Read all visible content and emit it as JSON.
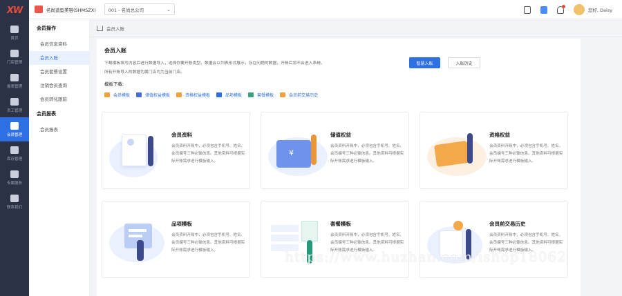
{
  "brand": {
    "logo_text": "XW"
  },
  "rail": [
    {
      "label": "首页",
      "icon": "home-icon"
    },
    {
      "label": "门店管理",
      "icon": "store-icon"
    },
    {
      "label": "报表管理",
      "icon": "chart-icon"
    },
    {
      "label": "员工管理",
      "icon": "staff-icon"
    },
    {
      "label": "会员管理",
      "icon": "member-icon",
      "active": true
    },
    {
      "label": "库存管理",
      "icon": "stock-icon"
    },
    {
      "label": "专属服务",
      "icon": "service-icon"
    },
    {
      "label": "联系我们",
      "icon": "contact-icon"
    }
  ],
  "topbar": {
    "store_name": "名尚造型美容(SHMSZX)",
    "branch_select": "001 - 名尚总公司",
    "user_greeting": "您好,  Daisy"
  },
  "subnav": {
    "group1": "会员操作",
    "items1": [
      "会员信息资料",
      "会员入账",
      "会员套餐设置",
      "注销会员查询",
      "会员转化跟踪"
    ],
    "group2": "会员报表",
    "items2": [
      "会员报表"
    ]
  },
  "breadcrumb": "会员入账",
  "panel": {
    "title": "会员入账",
    "desc_line1": "下载模板填写内容后进行数据导入，选择你要开账类型。数据会以列表形式展示，存在问题的数据，开账后将不会进入系统。",
    "desc_line2": "所有开账导入的数据均属门店均为当前门店。",
    "btn_primary": "智慧入账",
    "btn_default": "入账历史",
    "template_label": "模板下载:",
    "templates": [
      {
        "label": "会员模板",
        "color": "#f0a03c"
      },
      {
        "label": "储值权益模板",
        "color": "#4b6bd6"
      },
      {
        "label": "资格权益模板",
        "color": "#f0a03c"
      },
      {
        "label": "品项模板",
        "color": "#2f6fe4"
      },
      {
        "label": "套餐模板",
        "color": "#3aa17e"
      },
      {
        "label": "会员前交易历史",
        "color": "#f0a03c"
      }
    ],
    "cards": [
      {
        "title": "会员资料",
        "desc": "会员资料开账中，必须包含手机号、姓名、会员编号三种必输信息。其他资料可根据实际开账需求进行模板输入。"
      },
      {
        "title": "储值权益",
        "desc": "会员资料开账中，必须包含手机号、姓名、会员编号三种必输信息。其他资料可根据实际开账需求进行模板输入。"
      },
      {
        "title": "资格权益",
        "desc": "会员资料开账中，必须包含手机号、姓名、会员编号三种必输信息。其他资料可根据实际开账需求进行模板输入。"
      },
      {
        "title": "品项模板",
        "desc": "会员资料开账中，必须包含手机号、姓名、会员编号三种必输信息。其他资料可根据实际开账需求进行模板输入。"
      },
      {
        "title": "套餐模板",
        "desc": "会员资料开账中，必须包含手机号、姓名、会员编号三种必输信息。其他资料可根据实际开账需求进行模板输入。"
      },
      {
        "title": "会员前交易历史",
        "desc": "会员资料开账中，必须包含手机号、姓名、会员编号三种必输信息。其他资料可根据实际开账需求进行模板输入。"
      }
    ]
  },
  "watermark": "https://www.huzhan.com/ishop18062"
}
